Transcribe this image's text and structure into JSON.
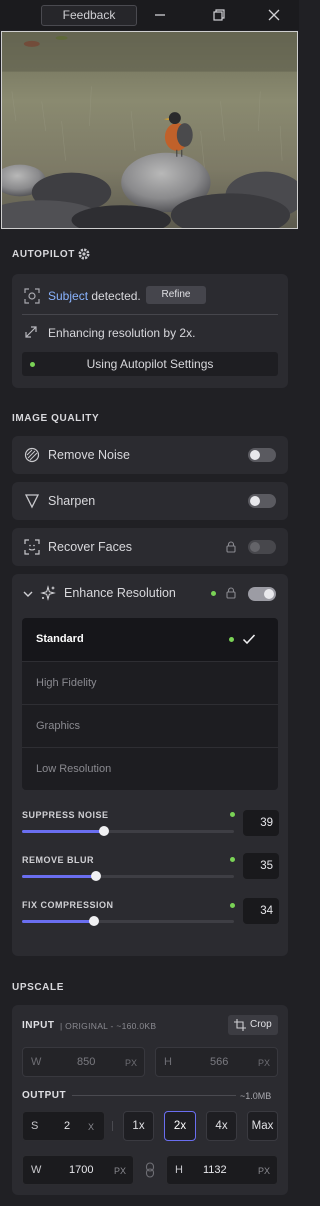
{
  "titlebar": {
    "feedback_label": "Feedback"
  },
  "autopilot": {
    "heading": "AUTOPILOT",
    "subject_word": "Subject",
    "detected_text": "detected.",
    "refine_label": "Refine",
    "enhancing_text": "Enhancing resolution by 2x.",
    "settings_label": "Using Autopilot Settings"
  },
  "image_quality": {
    "heading": "IMAGE QUALITY",
    "remove_noise": {
      "label": "Remove Noise",
      "on": false
    },
    "sharpen": {
      "label": "Sharpen",
      "on": false
    },
    "recover_faces": {
      "label": "Recover Faces",
      "on": false
    },
    "enhance_resolution": {
      "label": "Enhance Resolution",
      "on": true
    }
  },
  "modes": [
    {
      "label": "Standard",
      "selected": true
    },
    {
      "label": "High Fidelity",
      "selected": false
    },
    {
      "label": "Graphics",
      "selected": false
    },
    {
      "label": "Low Resolution",
      "selected": false
    }
  ],
  "sliders": [
    {
      "label": "SUPPRESS NOISE",
      "value": "39",
      "fraction": 0.39
    },
    {
      "label": "REMOVE BLUR",
      "value": "35",
      "fraction": 0.35
    },
    {
      "label": "FIX COMPRESSION",
      "value": "34",
      "fraction": 0.34
    }
  ],
  "upscale": {
    "heading": "UPSCALE",
    "input_label": "INPUT",
    "input_meta": "| ORIGINAL - ~160.0KB",
    "crop_label": "Crop",
    "input_w_key": "W",
    "input_w": "850",
    "input_w_unit": "PX",
    "input_h_key": "H",
    "input_h": "566",
    "input_h_unit": "PX",
    "output_label": "OUTPUT",
    "output_size": "~1.0MB",
    "scale_key": "S",
    "scale_value": "2",
    "scale_unit": "X",
    "presets": [
      "1x",
      "2x",
      "4x",
      "Max"
    ],
    "selected_preset": "2x",
    "output_w_key": "W",
    "output_w": "1700",
    "output_w_unit": "PX",
    "output_h_key": "H",
    "output_h": "1132",
    "output_h_unit": "PX"
  },
  "colors": {
    "accent": "#6a6ef0",
    "status_green": "#7ad356",
    "link_blue": "#8ab4ff"
  }
}
